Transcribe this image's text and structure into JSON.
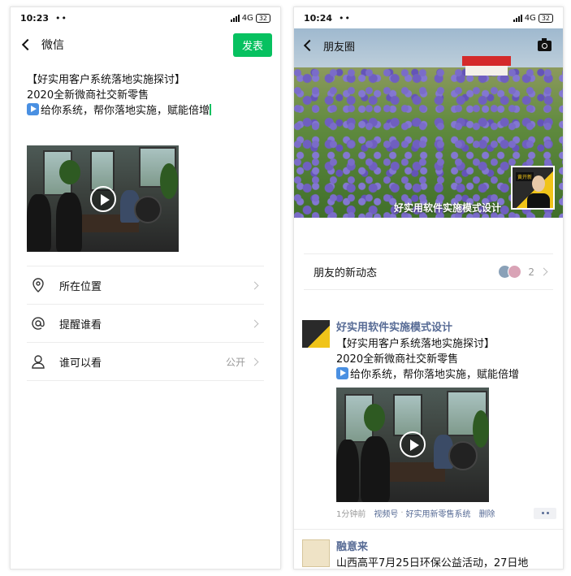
{
  "left": {
    "status": {
      "time": "10:23",
      "dots": "••",
      "network": "4G",
      "battery": "32"
    },
    "nav": {
      "title": "微信",
      "publish_label": "发表"
    },
    "post": {
      "line1": "【好实用客户系统落地实施探讨】",
      "line2": "2020全新微商社交新零售",
      "line3": "给你系统，帮你落地实施，赋能倍增"
    },
    "options": [
      {
        "label": "所在位置",
        "value": "",
        "icon": "location-pin-icon"
      },
      {
        "label": "提醒谁看",
        "value": "",
        "icon": "at-sign-icon"
      },
      {
        "label": "谁可以看",
        "value": "公开",
        "icon": "person-icon"
      }
    ]
  },
  "right": {
    "status": {
      "time": "10:24",
      "dots": "••",
      "network": "4G",
      "battery": "32"
    },
    "nav": {
      "title": "朋友圈"
    },
    "cover_caption": "好实用软件实施模式设计",
    "avatar_tag": "黄开新",
    "new_moments": {
      "label": "朋友的新动态",
      "count": "2"
    },
    "feed": [
      {
        "name": "好实用软件实施模式设计",
        "line1": "【好实用客户系统落地实施探讨】",
        "line2": "2020全新微商社交新零售",
        "line3": "给你系统，帮你落地实施，赋能倍增",
        "time": "1分钟前",
        "source": "视频号",
        "channel": "好实用新零售系统",
        "delete": "删除"
      },
      {
        "name": "融意来",
        "line1": "山西高平7月25日环保公益活动，27日地"
      }
    ]
  },
  "colors": {
    "wechat_green": "#07c160",
    "link_blue": "#576b95"
  }
}
